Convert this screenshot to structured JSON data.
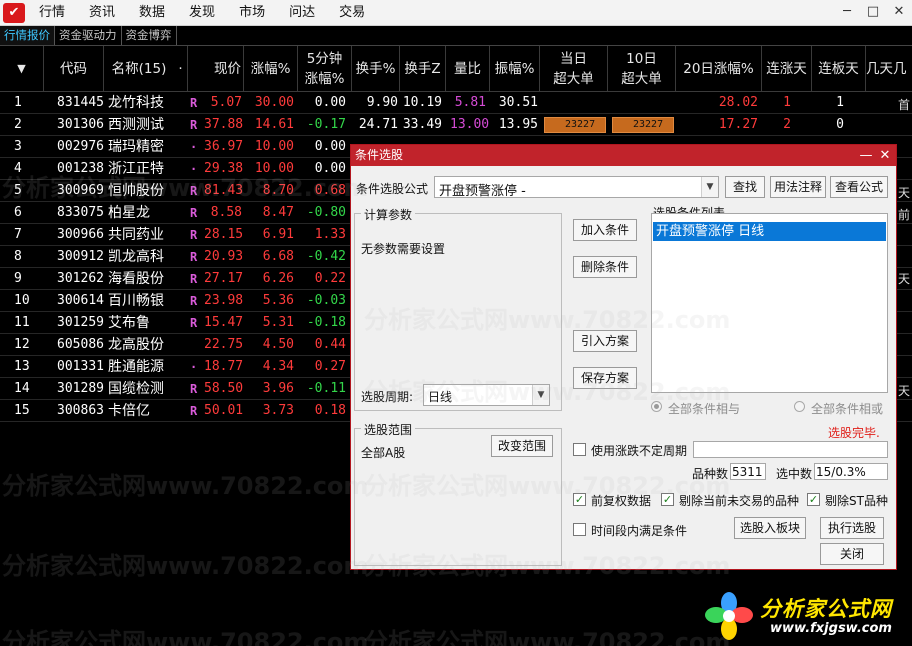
{
  "app": {
    "logo_glyph": "✔",
    "menu": [
      "行情",
      "资讯",
      "数据",
      "发现",
      "市场",
      "问达",
      "交易"
    ],
    "window_controls": [
      "─",
      "□",
      "✕"
    ]
  },
  "subtabs": [
    "行情报价",
    "资金驱动力",
    "资金博弈"
  ],
  "table": {
    "sort_glyph": "▼",
    "headers": [
      "代码",
      "名称(15)",
      "·",
      "现价",
      "涨幅%",
      "5分钟\n涨幅%",
      "换手%",
      "换手Z",
      "量比",
      "振幅%",
      "当日\n超大单",
      "10日\n超大单",
      "20日涨幅%",
      "连涨天",
      "连板天",
      "几天几"
    ],
    "rows": [
      {
        "idx": "1",
        "code": "831445",
        "name": "龙竹科技",
        "mark": "R",
        "price": "5.07",
        "chg": "30.00",
        "m5": "0.00",
        "m5c": "white",
        "hs": "9.90",
        "hsz": "10.19",
        "lb": "5.81",
        "zf": "30.51",
        "bar1": "",
        "bar2": "",
        "d20": "28.02",
        "lzt": "1",
        "lbt": "1"
      },
      {
        "idx": "2",
        "code": "301306",
        "name": "西测测试",
        "mark": "R",
        "price": "37.88",
        "chg": "14.61",
        "m5": "-0.17",
        "m5c": "green",
        "hs": "24.71",
        "hsz": "33.49",
        "lb": "13.00",
        "zf": "13.95",
        "bar1": "23227",
        "bar2": "23227",
        "d20": "17.27",
        "lzt": "2",
        "lbt": "0"
      },
      {
        "idx": "3",
        "code": "002976",
        "name": "瑞玛精密",
        "mark": "·",
        "price": "36.97",
        "chg": "10.00",
        "m5": "0.00",
        "m5c": "white",
        "hs": "",
        "hsz": "",
        "lb": "",
        "zf": "",
        "bar1": "",
        "bar2": "",
        "d20": "",
        "lzt": "",
        "lbt": ""
      },
      {
        "idx": "4",
        "code": "001238",
        "name": "浙江正特",
        "mark": "·",
        "price": "29.38",
        "chg": "10.00",
        "m5": "0.00",
        "m5c": "white",
        "hs": "",
        "hsz": "",
        "lb": "",
        "zf": "",
        "bar1": "",
        "bar2": "",
        "d20": "",
        "lzt": "",
        "lbt": ""
      },
      {
        "idx": "5",
        "code": "300969",
        "name": "恒帅股份",
        "mark": "R",
        "price": "81.43",
        "chg": "8.70",
        "m5": "0.68",
        "m5c": "red",
        "hs": "",
        "hsz": "",
        "lb": "",
        "zf": "",
        "bar1": "",
        "bar2": "",
        "d20": "",
        "lzt": "",
        "lbt": ""
      },
      {
        "idx": "6",
        "code": "833075",
        "name": "柏星龙",
        "mark": "R",
        "price": "8.58",
        "chg": "8.47",
        "m5": "-0.80",
        "m5c": "green",
        "hs": "",
        "hsz": "",
        "lb": "",
        "zf": "",
        "bar1": "",
        "bar2": "",
        "d20": "",
        "lzt": "",
        "lbt": ""
      },
      {
        "idx": "7",
        "code": "300966",
        "name": "共同药业",
        "mark": "R",
        "price": "28.15",
        "chg": "6.91",
        "m5": "1.33",
        "m5c": "red",
        "hs": "",
        "hsz": "",
        "lb": "",
        "zf": "",
        "bar1": "",
        "bar2": "",
        "d20": "",
        "lzt": "",
        "lbt": ""
      },
      {
        "idx": "8",
        "code": "300912",
        "name": "凯龙高科",
        "mark": "R",
        "price": "20.93",
        "chg": "6.68",
        "m5": "-0.42",
        "m5c": "green",
        "hs": "",
        "hsz": "",
        "lb": "",
        "zf": "",
        "bar1": "",
        "bar2": "",
        "d20": "",
        "lzt": "",
        "lbt": ""
      },
      {
        "idx": "9",
        "code": "301262",
        "name": "海看股份",
        "mark": "R",
        "price": "27.17",
        "chg": "6.26",
        "m5": "0.22",
        "m5c": "red",
        "hs": "",
        "hsz": "",
        "lb": "",
        "zf": "",
        "bar1": "",
        "bar2": "",
        "d20": "",
        "lzt": "",
        "lbt": ""
      },
      {
        "idx": "10",
        "code": "300614",
        "name": "百川畅银",
        "mark": "R",
        "price": "23.98",
        "chg": "5.36",
        "m5": "-0.03",
        "m5c": "green",
        "hs": "",
        "hsz": "",
        "lb": "",
        "zf": "",
        "bar1": "",
        "bar2": "",
        "d20": "",
        "lzt": "",
        "lbt": ""
      },
      {
        "idx": "11",
        "code": "301259",
        "name": "艾布鲁",
        "mark": "R",
        "price": "15.47",
        "chg": "5.31",
        "m5": "-0.18",
        "m5c": "green",
        "hs": "",
        "hsz": "",
        "lb": "",
        "zf": "",
        "bar1": "",
        "bar2": "",
        "d20": "",
        "lzt": "",
        "lbt": ""
      },
      {
        "idx": "12",
        "code": "605086",
        "name": "龙高股份",
        "mark": "",
        "price": "22.75",
        "chg": "4.50",
        "m5": "0.44",
        "m5c": "red",
        "hs": "",
        "hsz": "",
        "lb": "",
        "zf": "",
        "bar1": "",
        "bar2": "",
        "d20": "",
        "lzt": "",
        "lbt": ""
      },
      {
        "idx": "13",
        "code": "001331",
        "name": "胜通能源",
        "mark": "·",
        "price": "18.77",
        "chg": "4.34",
        "m5": "0.27",
        "m5c": "red",
        "hs": "",
        "hsz": "",
        "lb": "",
        "zf": "",
        "bar1": "",
        "bar2": "",
        "d20": "",
        "lzt": "",
        "lbt": ""
      },
      {
        "idx": "14",
        "code": "301289",
        "name": "国缆检测",
        "mark": "R",
        "price": "58.50",
        "chg": "3.96",
        "m5": "-0.11",
        "m5c": "green",
        "hs": "",
        "hsz": "",
        "lb": "",
        "zf": "",
        "bar1": "",
        "bar2": "",
        "d20": "",
        "lzt": "",
        "lbt": ""
      },
      {
        "idx": "15",
        "code": "300863",
        "name": "卡倍亿",
        "mark": "R",
        "price": "50.01",
        "chg": "3.73",
        "m5": "0.18",
        "m5c": "red",
        "hs": "",
        "hsz": "",
        "lb": "",
        "zf": "",
        "bar1": "",
        "bar2": "",
        "d20": "",
        "lzt": "",
        "lbt": ""
      }
    ],
    "right_edge_chars": [
      "首",
      "天",
      "前",
      "天",
      "天"
    ]
  },
  "dialog": {
    "title": "条件选股",
    "minimize_glyph": "—",
    "close_glyph": "✕",
    "formula_label": "条件选股公式",
    "formula_value": "开盘预警涨停 -",
    "find_btn": "查找",
    "usage_btn": "用法注释",
    "view_btn": "查看公式",
    "params_title": "计算参数",
    "params_text": "无参数需要设置",
    "period_label": "选股周期:",
    "period_value": "日线",
    "add_btn": "加入条件",
    "del_btn": "删除条件",
    "import_btn": "引入方案",
    "save_btn": "保存方案",
    "list_title": "选股条件列表",
    "list_items": [
      "开盘预警涨停  日线"
    ],
    "radio_and": "全部条件相与",
    "radio_or": "全部条件相或",
    "status": "选股完毕.",
    "range_title": "选股范围",
    "range_value": "全部A股",
    "range_btn": "改变范围",
    "use_period_label": "使用涨跌不定周期",
    "count_label": "品种数",
    "count_value": "5311",
    "selected_label": "选中数",
    "selected_value": "15/0.3%",
    "fq_label": "前复权数据",
    "exclude_label": "剔除当前未交易的品种",
    "st_label": "剔除ST品种",
    "time_label": "时间段内满足条件",
    "to_block_btn": "选股入板块",
    "run_btn": "执行选股",
    "close_btn": "关闭"
  },
  "watermark": "分析家公式网www.70822.com",
  "corner_logo": {
    "t1": "分析家公式网",
    "t2": "www.fxjgsw.com"
  }
}
